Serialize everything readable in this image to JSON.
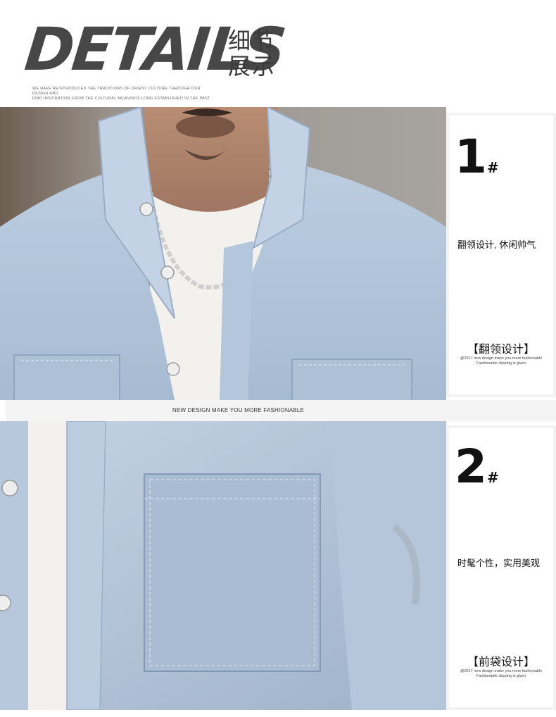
{
  "header": {
    "title_en": "DETAILS",
    "title_cn_line1": "细节",
    "title_cn_line2": "展示",
    "tagline_line1": "WE HAVE REINTRODUCED THE TRADITIONS OF ORIENT CULTURE THROUGH OUR DESIGN AND",
    "tagline_line2": "FIND INSPIRATION FROM THE CULTURAL MEANINGS LONG ESTABLISHED IN THE PAST"
  },
  "divider": {
    "text": "NEW DESIGN MAKE YOU MORE FASHIONABLE"
  },
  "details": [
    {
      "number": "1",
      "hash": "#",
      "description": "翻领设计, 休闲帅气",
      "feature": "【翻领设计】",
      "small_line1": "@2017 new design make you more fashionable",
      "small_line2": "Fashionable clipping is given"
    },
    {
      "number": "2",
      "hash": "#",
      "description": "时髦个性，实用美观",
      "feature": "【前袋设计】",
      "small_line1": "@2017 new design make you more fashionable",
      "small_line2": "Fashionable clipping is given"
    }
  ],
  "colors": {
    "denim_light": "#b8cbe0",
    "denim_mid": "#9fb6d0",
    "tshirt": "#f3f1ee",
    "title_gray": "#474747"
  }
}
